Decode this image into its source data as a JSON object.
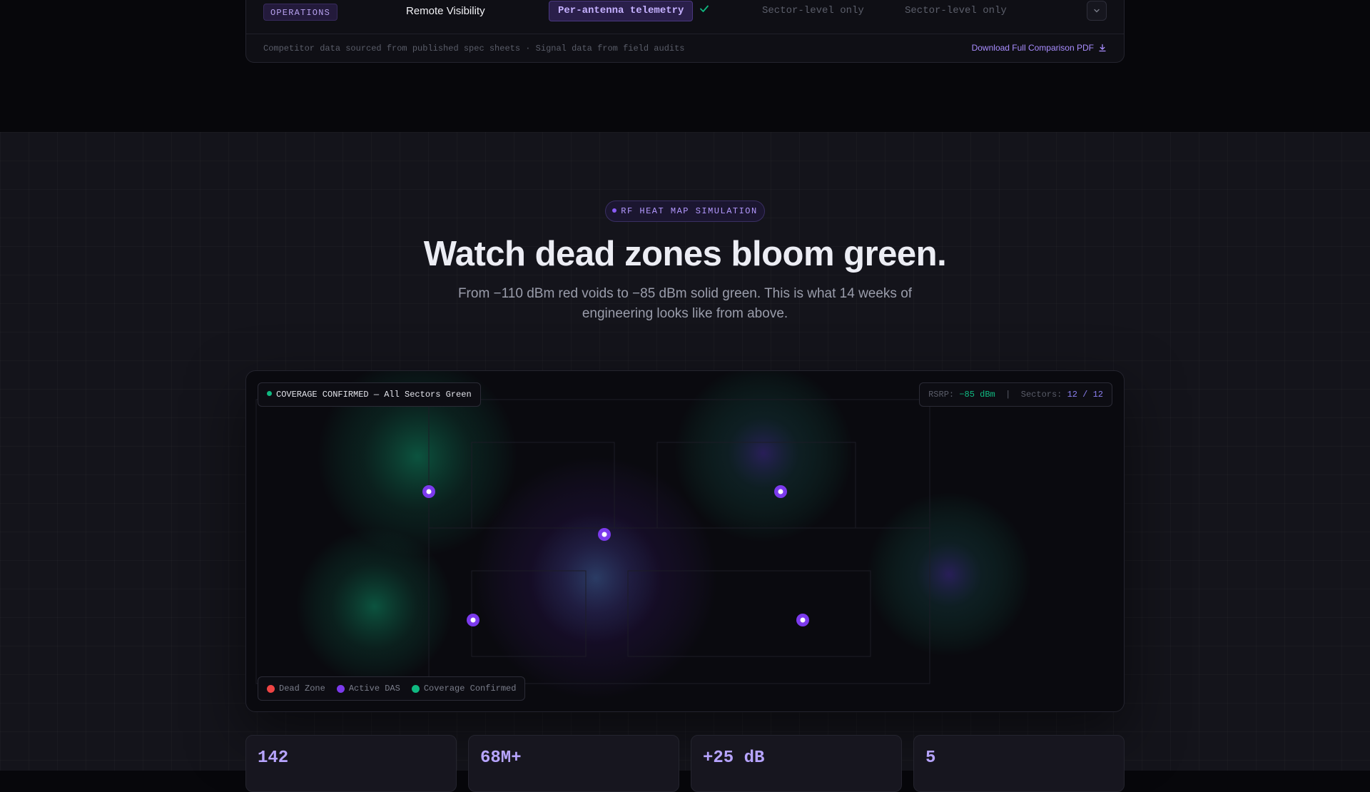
{
  "comparison": {
    "row": {
      "category": "OPERATIONS",
      "feature": "Remote Visibility",
      "ours": "Per-antenna telemetry",
      "competitor_1": "Sector-level only",
      "competitor_2": "Sector-level only"
    },
    "source_note": "Competitor data sourced from published spec sheets · Signal data from field audits",
    "download_label": "Download Full Comparison PDF"
  },
  "section": {
    "eyebrow": "RF HEAT MAP SIMULATION",
    "title": "Watch dead zones bloom green.",
    "subtitle": "From −110 dBm red voids to −85 dBm solid green. This is what 14 weeks of engineering looks like from above."
  },
  "heatmap": {
    "status": "COVERAGE CONFIRMED — All Sectors Green",
    "rsrp_label": "RSRP:",
    "rsrp_value": "−85 dBm",
    "divider": "|",
    "sectors_label": "Sectors:",
    "sectors_value": "12 / 12",
    "antenna_count": 5,
    "legend": [
      {
        "label": "Dead Zone",
        "color": "#ef4444"
      },
      {
        "label": "Active DAS",
        "color": "#7c3aed"
      },
      {
        "label": "Coverage Confirmed",
        "color": "#10b981"
      }
    ]
  },
  "stats": [
    {
      "value": "142"
    },
    {
      "value": "68M+"
    },
    {
      "value": "+25 dB"
    },
    {
      "value": "5"
    }
  ],
  "colors": {
    "accent": "#8b5cf6",
    "success": "#10b981",
    "danger": "#ef4444"
  }
}
